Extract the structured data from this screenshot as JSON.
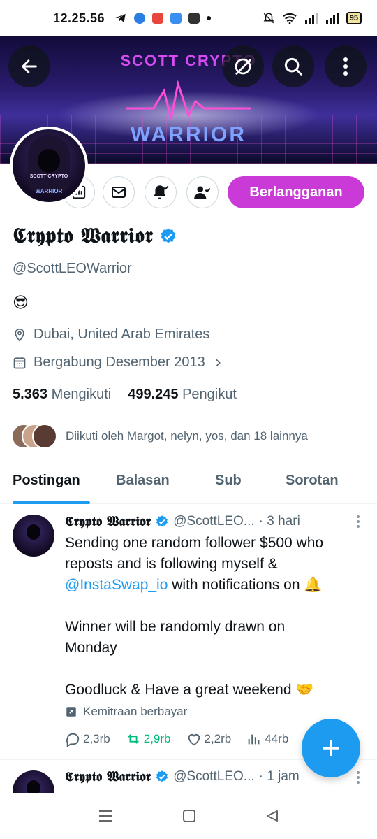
{
  "status_bar": {
    "time": "12.25.56",
    "battery": "95"
  },
  "banner": {
    "line1": "SCOTT CRYPTO",
    "line2": "WARRIOR"
  },
  "avatar": {
    "line1": "SCOTT CRYPTO",
    "line2": "WARRIOR"
  },
  "profile": {
    "name": "𝕮𝖗𝖞𝖕𝖙𝖔 𝖂𝖆𝖗𝖗𝖎𝖔𝖗",
    "handle": "@ScottLEOWarrior",
    "bio_emoji": "😎",
    "location": "Dubai, United Arab Emirates",
    "joined": "Bergabung Desember 2013",
    "following_count": "5.363",
    "following_label": "Mengikuti",
    "followers_count": "499.245",
    "followers_label": "Pengikut",
    "followed_by": "Diikuti oleh Margot, nelyn, yos, dan 18 lainnya",
    "subscribe_label": "Berlangganan"
  },
  "tabs": [
    "Postingan",
    "Balasan",
    "Sub",
    "Sorotan"
  ],
  "posts": [
    {
      "name": "𝕮𝖗𝖞𝖕𝖙𝖔 𝖂𝖆𝖗𝖗𝖎𝖔𝖗",
      "handle": "@ScottLEO...",
      "time": "· 3 hari",
      "line1": "Sending one random follower $500 who",
      "line2": "reposts and is following myself &",
      "mention": "@InstaSwap_io",
      "line3_rest": " with notifications on 🔔",
      "line4": "Winner will be randomly drawn on",
      "line5": "Monday",
      "line6": "Goodluck & Have a great weekend 🤝",
      "paid_label": "Kemitraan berbayar",
      "replies": "2,3rb",
      "reposts": "2,9rb",
      "likes": "2,2rb",
      "views": "44rb"
    },
    {
      "name": "𝕮𝖗𝖞𝖕𝖙𝖔 𝖂𝖆𝖗𝖗𝖎𝖔𝖗",
      "handle": "@ScottLEO...",
      "time": "· 1 jam"
    }
  ],
  "colors": {
    "accent": "#1d9bf0",
    "subscribe": "#c93ad6",
    "repost": "#00ba7c"
  }
}
